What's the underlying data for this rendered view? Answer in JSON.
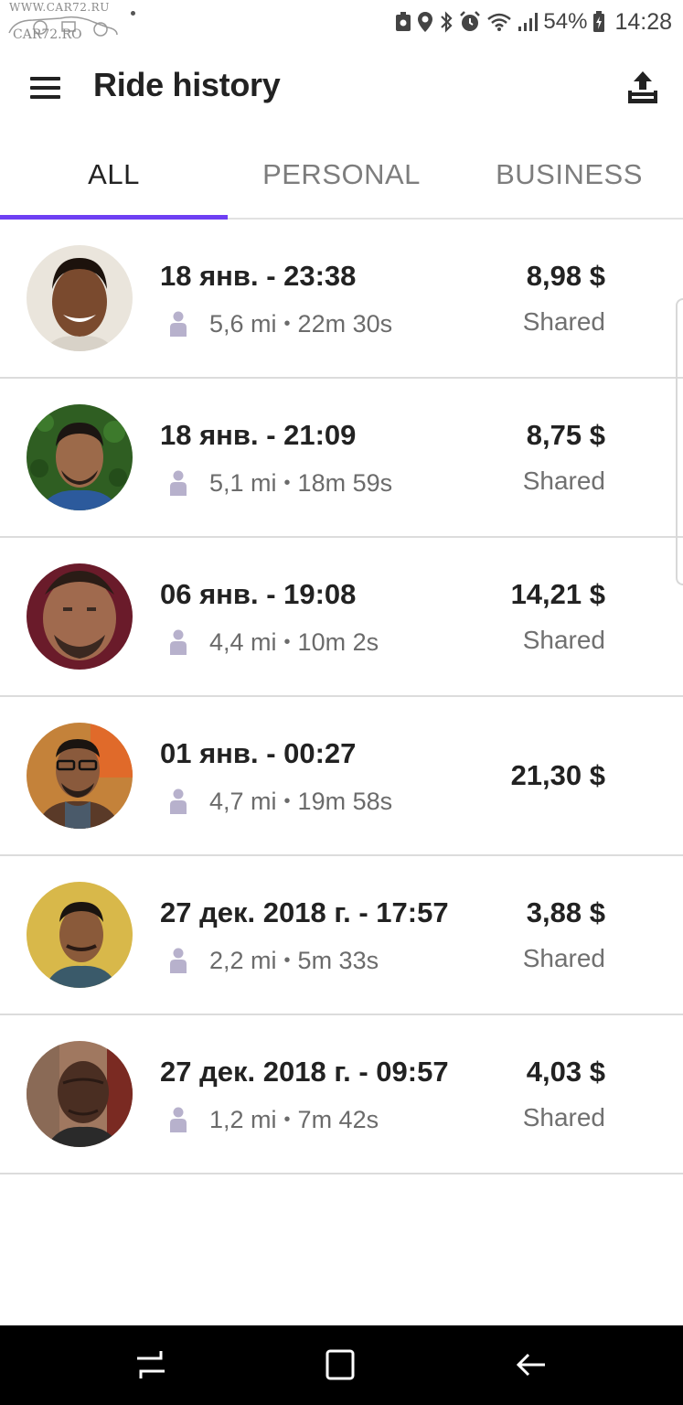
{
  "status_bar": {
    "watermark_top": "WWW.CAR72.RU",
    "watermark_bottom": "CAR72.RO",
    "battery_percent": "54%",
    "time": "14:28",
    "icons": [
      "notification-icon",
      "location-icon",
      "bluetooth-icon",
      "alarm-icon",
      "wifi-icon",
      "signal-icon",
      "battery-icon"
    ]
  },
  "header": {
    "title": "Ride history",
    "menu_icon": "hamburger-menu-icon",
    "export_icon": "export-icon"
  },
  "tabs": [
    {
      "label": "ALL",
      "active": true
    },
    {
      "label": "PERSONAL",
      "active": false
    },
    {
      "label": "BUSINESS",
      "active": false
    }
  ],
  "accent_color": "#6e3ff3",
  "rides": [
    {
      "date": "18 янв. - 23:38",
      "distance": "5,6 mi",
      "duration": "22m 30s",
      "price": "8,98 $",
      "type": "Shared"
    },
    {
      "date": "18 янв. - 21:09",
      "distance": "5,1 mi",
      "duration": "18m 59s",
      "price": "8,75 $",
      "type": "Shared"
    },
    {
      "date": "06 янв. - 19:08",
      "distance": "4,4 mi",
      "duration": "10m 2s",
      "price": "14,21 $",
      "type": "Shared"
    },
    {
      "date": "01 янв. - 00:27",
      "distance": "4,7 mi",
      "duration": "19m 58s",
      "price": "21,30 $",
      "type": ""
    },
    {
      "date": "27 дек. 2018 г. - 17:57",
      "distance": "2,2 mi",
      "duration": "5m 33s",
      "price": "3,88 $",
      "type": "Shared"
    },
    {
      "date": "27 дек. 2018 г. - 09:57",
      "distance": "1,2 mi",
      "duration": "7m 42s",
      "price": "4,03 $",
      "type": "Shared"
    }
  ],
  "nav_bar": {
    "icons": [
      "recent-apps-icon",
      "home-icon",
      "back-icon"
    ]
  }
}
